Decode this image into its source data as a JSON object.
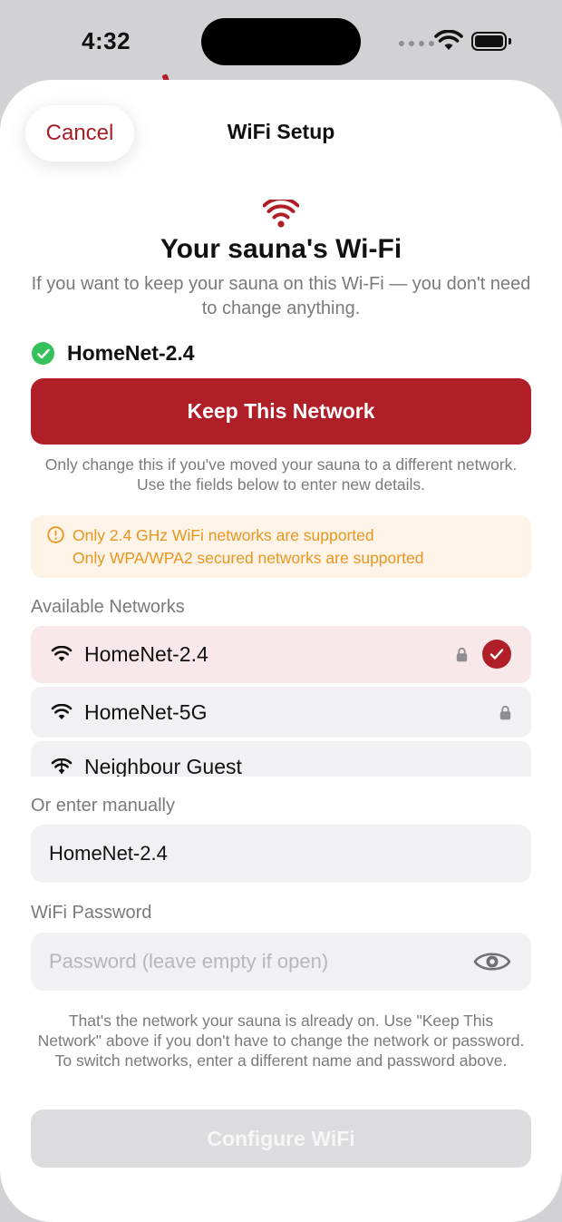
{
  "status_bar": {
    "time": "4:32",
    "wifi_icon": "wifi-icon",
    "battery_icon": "battery-icon"
  },
  "header": {
    "cancel_label": "Cancel",
    "title": "WiFi Setup"
  },
  "hero": {
    "icon": "wifi-icon",
    "title": "Your sauna's Wi-Fi",
    "description": "If you want to keep your sauna on this Wi-Fi — you don't need to change anything."
  },
  "current": {
    "network_name": "HomeNet-2.4",
    "icon": "checkmark-circle-icon"
  },
  "keep": {
    "button_label": "Keep This Network",
    "note": "Only change this if you've moved your sauna to a different network. Use the fields below to enter new details."
  },
  "warning": {
    "icon": "info-circle-icon",
    "line1": "Only 2.4 GHz WiFi networks are supported",
    "line2": "Only WPA/WPA2 secured networks are supported"
  },
  "networks": {
    "label": "Available Networks",
    "items": [
      {
        "name": "HomeNet-2.4",
        "secured": true,
        "selected": true
      },
      {
        "name": "HomeNet-5G",
        "secured": true,
        "selected": false
      },
      {
        "name": "Neighbour Guest",
        "secured": false,
        "selected": false
      }
    ]
  },
  "manual": {
    "label": "Or enter manually",
    "value": "HomeNet-2.4"
  },
  "password": {
    "label": "WiFi Password",
    "placeholder": "Password (leave empty if open)",
    "toggle_icon": "eye-icon"
  },
  "footer_note": "That's the network your sauna is already on. Use \"Keep This Network\" above if you don't have to change the network or password. To switch networks, enter a different name and password above.",
  "configure": {
    "button_label": "Configure WiFi",
    "enabled": false
  },
  "colors": {
    "accent": "#b01e27",
    "success": "#35c15a",
    "warning_text": "#e8961f",
    "warning_bg": "#fdf3e7",
    "selected_row_bg": "#f8e8e9",
    "field_bg": "#f1f1f3",
    "secondary_text": "#7a7a7e"
  }
}
